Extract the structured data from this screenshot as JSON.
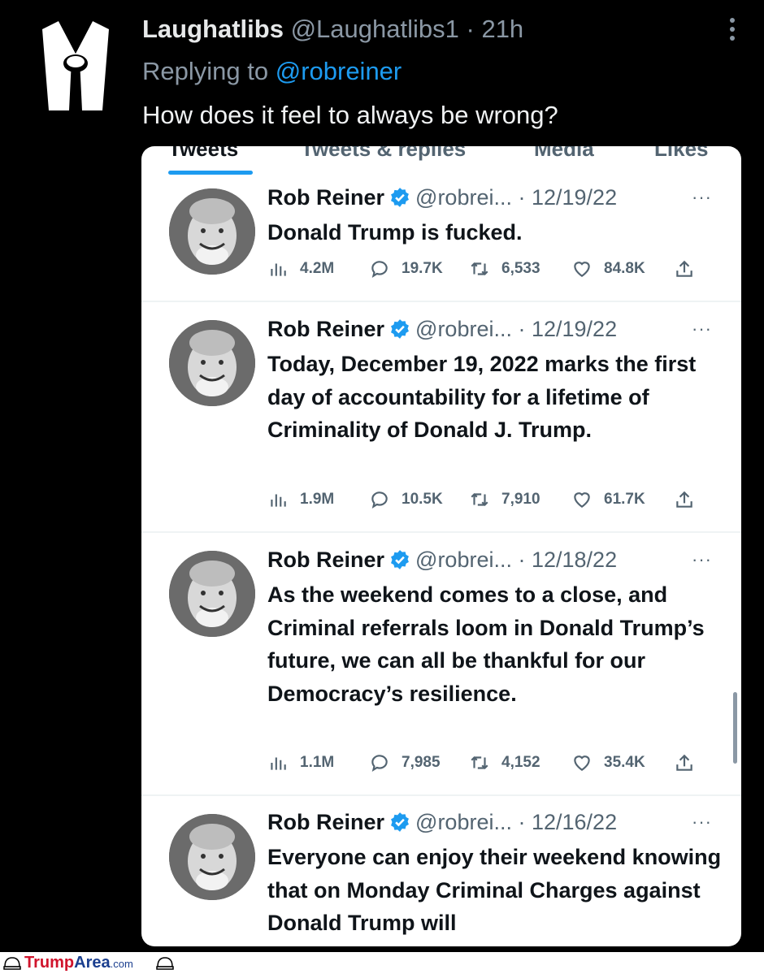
{
  "reply": {
    "display_name": "Laughatlibs",
    "handle": "@Laughatlibs1",
    "separator": "·",
    "time": "21h",
    "replying_prefix": "Replying to",
    "replying_to": "@robreiner",
    "text": "How does it feel to always be wrong?"
  },
  "profile_tabs": [
    "Tweets",
    "Tweets & replies",
    "Media",
    "Likes"
  ],
  "tweets": [
    {
      "name": "Rob Reiner",
      "handle": "@robrei...",
      "date": "· 12/19/22",
      "more": "···",
      "text": "Donald Trump is fucked.",
      "views": "4.2M",
      "replies": "19.7K",
      "retweets": "6,533",
      "likes": "84.8K"
    },
    {
      "name": "Rob Reiner",
      "handle": "@robrei...",
      "date": "· 12/19/22",
      "more": "···",
      "text": "Today, December 19, 2022 marks the first day of accountability for a lifetime of Criminality of Donald J. Trump.",
      "views": "1.9M",
      "replies": "10.5K",
      "retweets": "7,910",
      "likes": "61.7K"
    },
    {
      "name": "Rob Reiner",
      "handle": "@robrei...",
      "date": "· 12/18/22",
      "more": "···",
      "text": "As the weekend comes to a close, and Criminal referrals loom in Donald Trump’s future, we can all be thankful for our Democracy’s resilience.",
      "views": "1.1M",
      "replies": "7,985",
      "retweets": "4,152",
      "likes": "35.4K"
    },
    {
      "name": "Rob Reiner",
      "handle": "@robrei...",
      "date": "· 12/16/22",
      "more": "···",
      "text": "Everyone can enjoy their weekend knowing that on Monday Criminal Charges against Donald Trump will"
    }
  ],
  "watermark": {
    "trump": "Trump",
    "area": "Area",
    "com": ".com"
  },
  "colors": {
    "accent": "#1d9bf0",
    "background": "#000000",
    "card": "#ffffff",
    "muted": "#536471"
  }
}
